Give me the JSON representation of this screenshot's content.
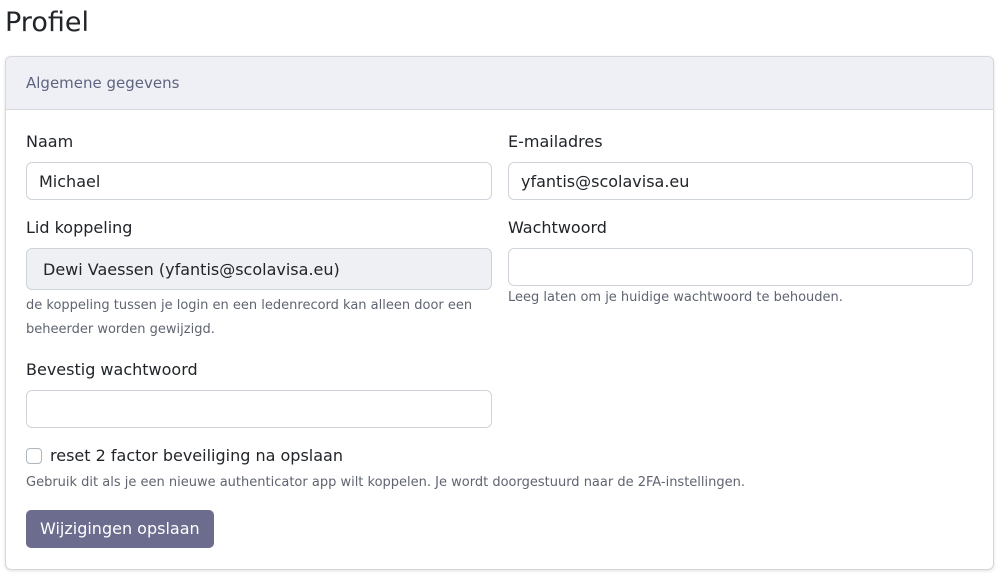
{
  "page": {
    "title": "Profiel"
  },
  "card": {
    "header": "Algemene gegevens"
  },
  "form": {
    "name": {
      "label": "Naam",
      "value": "Michael"
    },
    "email": {
      "label": "E-mailadres",
      "value": "yfantis@scolavisa.eu"
    },
    "member_link": {
      "label": "Lid koppeling",
      "value": "Dewi Vaessen (yfantis@scolavisa.eu)",
      "help": "de koppeling tussen je login en een ledenrecord kan alleen door een beheerder worden gewijzigd."
    },
    "password": {
      "label": "Wachtwoord",
      "value": "",
      "help": "Leeg laten om je huidige wachtwoord te behouden."
    },
    "confirm_password": {
      "label": "Bevestig wachtwoord",
      "value": ""
    },
    "reset_2fa": {
      "label": "reset 2 factor beveiliging na opslaan",
      "checked": false,
      "help": "Gebruik dit als je een nieuwe authenticator app wilt koppelen. Je wordt doorgestuurd naar de 2FA-instellingen."
    },
    "submit_label": "Wijzigingen opslaan"
  },
  "colors": {
    "primary_button": "#6c6c8e",
    "card_header_bg": "#eff0f5",
    "card_header_text": "#5e6480"
  }
}
